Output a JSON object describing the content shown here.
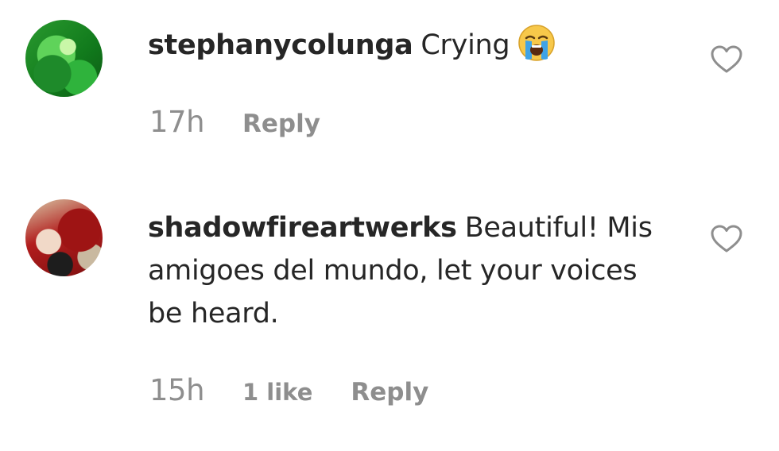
{
  "comments": [
    {
      "username": "stephanycolunga",
      "text": "Crying",
      "emoji": "loudly-crying-face",
      "time": "17h",
      "likes": "",
      "reply_label": "Reply"
    },
    {
      "username": "shadowfireartwerks",
      "text": "Beautiful! Mis amigoes del mundo, let your voices be heard.",
      "time": "15h",
      "likes": "1 like",
      "reply_label": "Reply"
    }
  ],
  "icons": {
    "like": "heart-outline-icon"
  },
  "colors": {
    "primary_text": "#262626",
    "secondary_text": "#8e8e8e"
  }
}
